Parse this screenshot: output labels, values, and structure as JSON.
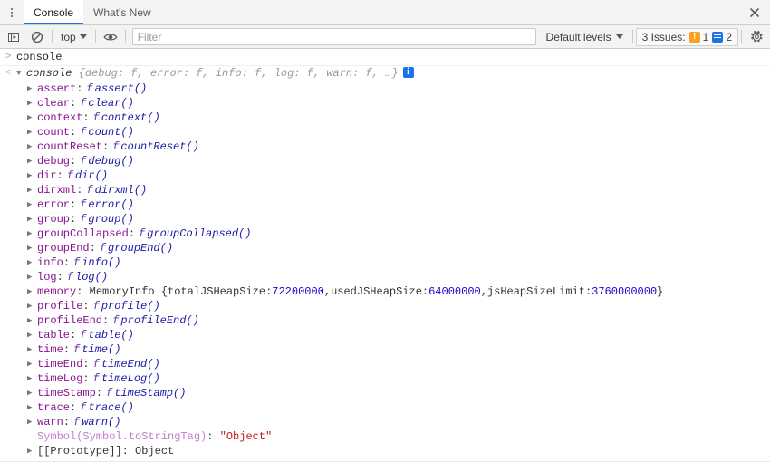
{
  "window": {
    "menu_icon": "kebab-menu-icon",
    "close_icon": "close-icon"
  },
  "tabs": [
    {
      "label": "Console",
      "active": true
    },
    {
      "label": "What's New",
      "active": false
    }
  ],
  "toolbar": {
    "execute_icon": "execute-snippet-icon",
    "clear_icon": "clear-console-icon",
    "context_selector": "top",
    "eye_icon": "live-expression-eye-icon",
    "filter_placeholder": "Filter",
    "filter_value": "",
    "levels_label": "Default levels",
    "issues_label": "3 Issues:",
    "issues_warning_count": "1",
    "issues_info_count": "2",
    "settings_icon": "gear-icon"
  },
  "console": {
    "command": {
      "gutter": ">",
      "text": "console"
    },
    "result": {
      "gutter": "<",
      "disclosure": "▼",
      "object_name": "console",
      "preview_open": "{",
      "preview_items": [
        "debug: f",
        "error: f",
        "info: f",
        "log: f",
        "warn: f",
        "…"
      ],
      "preview_close": "}",
      "info_badge": "info-icon"
    },
    "properties": [
      {
        "disclosure": "▶",
        "name": "assert",
        "fn": "f",
        "sig": "assert()"
      },
      {
        "disclosure": "▶",
        "name": "clear",
        "fn": "f",
        "sig": "clear()"
      },
      {
        "disclosure": "▶",
        "name": "context",
        "fn": "f",
        "sig": "context()"
      },
      {
        "disclosure": "▶",
        "name": "count",
        "fn": "f",
        "sig": "count()"
      },
      {
        "disclosure": "▶",
        "name": "countReset",
        "fn": "f",
        "sig": "countReset()"
      },
      {
        "disclosure": "▶",
        "name": "debug",
        "fn": "f",
        "sig": "debug()"
      },
      {
        "disclosure": "▶",
        "name": "dir",
        "fn": "f",
        "sig": "dir()"
      },
      {
        "disclosure": "▶",
        "name": "dirxml",
        "fn": "f",
        "sig": "dirxml()"
      },
      {
        "disclosure": "▶",
        "name": "error",
        "fn": "f",
        "sig": "error()"
      },
      {
        "disclosure": "▶",
        "name": "group",
        "fn": "f",
        "sig": "group()"
      },
      {
        "disclosure": "▶",
        "name": "groupCollapsed",
        "fn": "f",
        "sig": "groupCollapsed()"
      },
      {
        "disclosure": "▶",
        "name": "groupEnd",
        "fn": "f",
        "sig": "groupEnd()"
      },
      {
        "disclosure": "▶",
        "name": "info",
        "fn": "f",
        "sig": "info()"
      },
      {
        "disclosure": "▶",
        "name": "log",
        "fn": "f",
        "sig": "log()"
      }
    ],
    "memory_row": {
      "disclosure": "▶",
      "name": "memory",
      "class_name": "MemoryInfo",
      "open_brace": "{",
      "fields": [
        {
          "key": "totalJSHeapSize",
          "value": "72200000"
        },
        {
          "key": "usedJSHeapSize",
          "value": "64000000"
        },
        {
          "key": "jsHeapSizeLimit",
          "value": "3760000000"
        }
      ],
      "close_brace": "}"
    },
    "properties2": [
      {
        "disclosure": "▶",
        "name": "profile",
        "fn": "f",
        "sig": "profile()"
      },
      {
        "disclosure": "▶",
        "name": "profileEnd",
        "fn": "f",
        "sig": "profileEnd()"
      },
      {
        "disclosure": "▶",
        "name": "table",
        "fn": "f",
        "sig": "table()"
      },
      {
        "disclosure": "▶",
        "name": "time",
        "fn": "f",
        "sig": "time()"
      },
      {
        "disclosure": "▶",
        "name": "timeEnd",
        "fn": "f",
        "sig": "timeEnd()"
      },
      {
        "disclosure": "▶",
        "name": "timeLog",
        "fn": "f",
        "sig": "timeLog()"
      },
      {
        "disclosure": "▶",
        "name": "timeStamp",
        "fn": "f",
        "sig": "timeStamp()"
      },
      {
        "disclosure": "▶",
        "name": "trace",
        "fn": "f",
        "sig": "trace()"
      },
      {
        "disclosure": "▶",
        "name": "warn",
        "fn": "f",
        "sig": "warn()"
      }
    ],
    "symbol_row": {
      "name": "Symbol(Symbol.toStringTag)",
      "sep": ":",
      "value": "\"Object\""
    },
    "prototype_row": {
      "disclosure": "▶",
      "name": "[[Prototype]]",
      "sep": ":",
      "value": "Object"
    }
  },
  "colors": {
    "accent": "#1a73e8",
    "property_name": "#881391",
    "number": "#1c00cf",
    "string": "#c41a16",
    "function_sig": "#1a1aa6",
    "symbol": "#c17ecc",
    "warning": "#fa9f24"
  }
}
